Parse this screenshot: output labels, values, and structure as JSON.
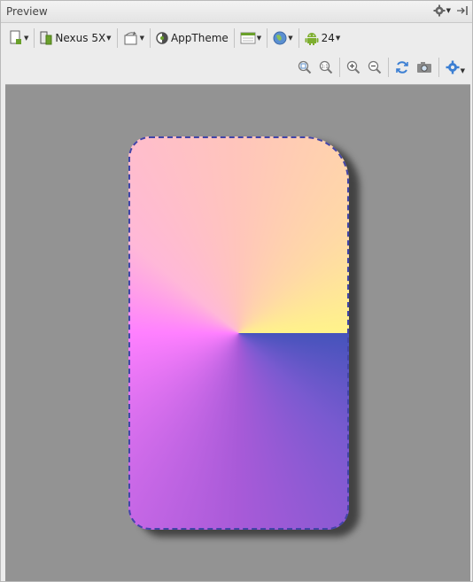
{
  "window": {
    "title": "Preview"
  },
  "toolbar": {
    "device": "Nexus 5X",
    "theme": "AppTheme",
    "api_level": "24"
  },
  "icons": {
    "settings": "gear-icon",
    "hide": "pin-to-side-icon",
    "design_surface": "design-surface-icon",
    "device": "phone-icon",
    "orientation": "rotate-icon",
    "theme": "theme-icon",
    "layout_variants": "layout-variants-icon",
    "locale": "globe-icon",
    "api": "android-icon",
    "zoom_fit": "zoom-to-fit-icon",
    "zoom_actual": "zoom-actual-size-icon",
    "zoom_in": "zoom-in-icon",
    "zoom_out": "zoom-out-icon",
    "refresh": "refresh-icon",
    "screenshot": "camera-icon",
    "options": "gear-icon"
  },
  "colors": {
    "canvas": "#939393",
    "device_border": "#4245a8",
    "gradient": [
      "#4553bb",
      "#7a5ad0",
      "#a85ad8",
      "#ff80ff",
      "#ffb8d8",
      "#ffc5bb",
      "#ffd9a6",
      "#fff38a"
    ]
  }
}
